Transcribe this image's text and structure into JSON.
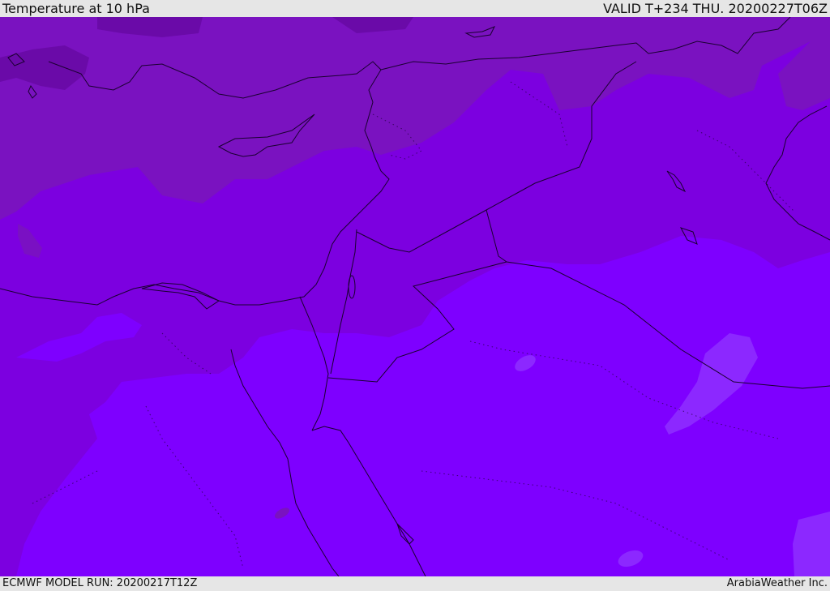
{
  "header": {
    "title": "Temperature at 10 hPa",
    "valid": "VALID T+234 THU. 20200227T06Z"
  },
  "footer": {
    "model_run": "ECMWF MODEL RUN: 20200217T12Z",
    "credit": "ArabiaWeather Inc."
  },
  "colors": {
    "dark_band": "#7a12c0",
    "mid_band": "#7c00e0",
    "light_band": "#7e00ff",
    "cold_pool": "#8c28ff",
    "coastline": "#1a0030",
    "background": "#e6e6e6"
  }
}
